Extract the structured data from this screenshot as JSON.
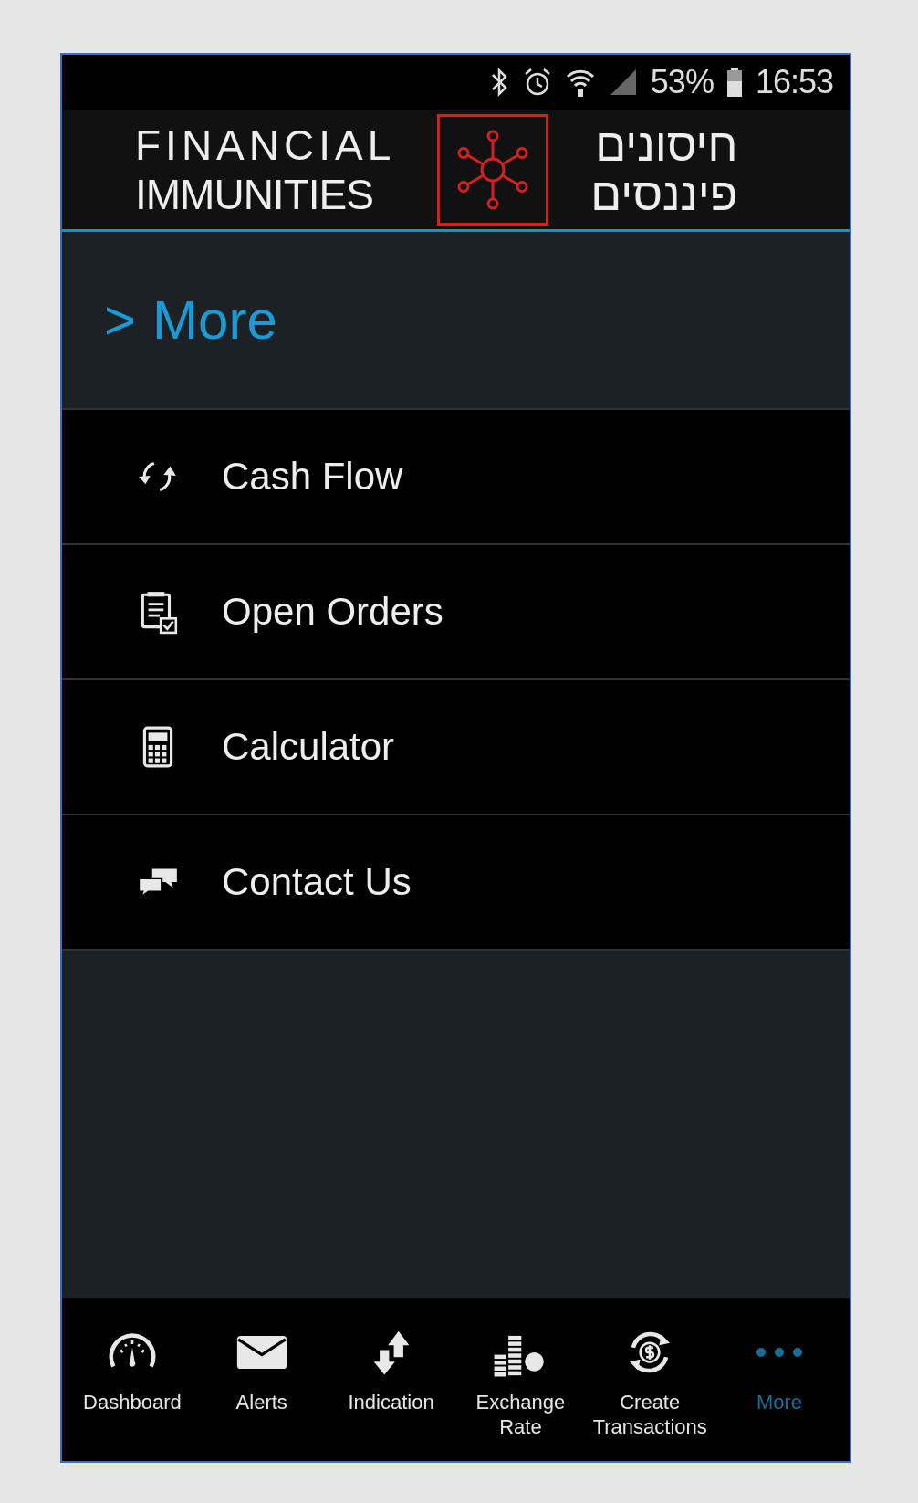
{
  "status_bar": {
    "battery": "53%",
    "time": "16:53"
  },
  "header": {
    "logo_text_lines": [
      "FINANCIAL",
      "IMMUNITIES"
    ],
    "hebrew_lines": [
      "חיסונים",
      "פיננסים"
    ]
  },
  "breadcrumb": {
    "marker": ">",
    "title": "More"
  },
  "menu": [
    {
      "label": "Cash Flow"
    },
    {
      "label": "Open Orders"
    },
    {
      "label": "Calculator"
    },
    {
      "label": "Contact Us"
    }
  ],
  "bottom_nav": [
    {
      "label": "Dashboard",
      "selected": false
    },
    {
      "label": "Alerts",
      "selected": false
    },
    {
      "label": "Indication",
      "selected": false
    },
    {
      "label": "Exchange Rate",
      "selected": false
    },
    {
      "label": "Create Transactions",
      "selected": false
    },
    {
      "label": "More",
      "selected": true
    }
  ]
}
